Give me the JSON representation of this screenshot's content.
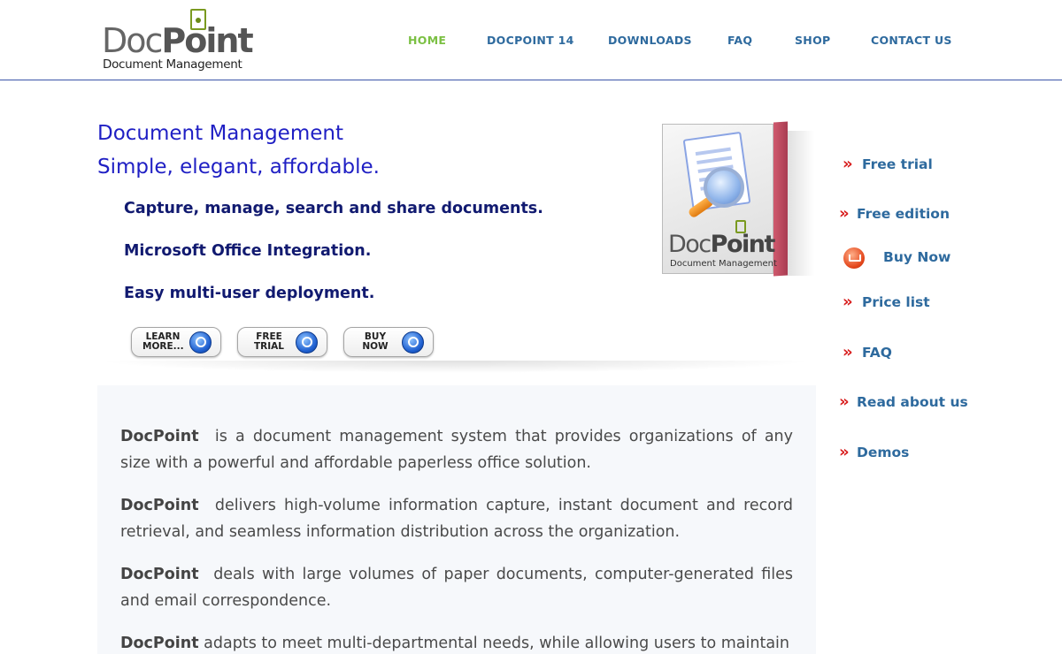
{
  "logo": {
    "word_doc": "Doc",
    "word_point": "Point",
    "subtitle": "Document Management"
  },
  "nav": {
    "items": [
      {
        "label": "HOME",
        "active": true
      },
      {
        "label": "DOCPOINT 14",
        "active": false
      },
      {
        "label": "DOWNLOADS",
        "active": false
      },
      {
        "label": "FAQ",
        "active": false
      },
      {
        "label": "SHOP",
        "active": false
      },
      {
        "label": "CONTACT US",
        "active": false
      }
    ]
  },
  "hero": {
    "title_line1": "Document Management",
    "title_line2": "Simple, elegant, affordable.",
    "features": [
      "Capture, manage, search and share documents.",
      "Microsoft Office Integration.",
      "Easy multi-user deployment."
    ],
    "buttons": [
      {
        "label": "LEARN\nMORE...",
        "icon": "magnifier-icon"
      },
      {
        "label": "FREE\nTRIAL",
        "icon": "magnifier-icon"
      },
      {
        "label": "BUY\nNOW",
        "icon": "cart-icon"
      }
    ]
  },
  "product_box": {
    "title_doc": "Doc",
    "title_point": "Point",
    "subtitle": "Document Management"
  },
  "sidebar": {
    "links": [
      {
        "label": "Free trial",
        "icon": "double-chevron-icon"
      },
      {
        "label": "Free edition",
        "icon": "double-chevron-icon"
      },
      {
        "label": "Buy Now",
        "icon": "shopping-cart-icon"
      },
      {
        "label": "Price list",
        "icon": "double-chevron-icon"
      },
      {
        "label": "FAQ",
        "icon": "double-chevron-icon"
      },
      {
        "label": "Read about us",
        "icon": "double-chevron-icon"
      },
      {
        "label": "Demos",
        "icon": "double-chevron-icon"
      }
    ],
    "arrow_glyph": "»"
  },
  "content": {
    "paragraphs": [
      {
        "brand": "DocPoint",
        "text": "is a document management system that provides organizations of any size with a powerful and affordable paperless office solution."
      },
      {
        "brand": "DocPoint",
        "text": "delivers high-volume information capture, instant document and record retrieval, and seamless information distribution across the organization."
      },
      {
        "brand": "DocPoint",
        "text": "deals with large volumes of paper documents, computer-generated files and email correspondence."
      },
      {
        "brand": "DocPoint",
        "text": "adapts to meet multi-departmental needs, while allowing users to maintain"
      }
    ]
  },
  "colors": {
    "nav_text": "#2e6a9e",
    "nav_active": "#7bc043",
    "hero_title": "#1f1fc4",
    "feature_text": "#111a70",
    "arrow_red": "#d81e1e",
    "panel_bg": "#f6f8fb"
  }
}
